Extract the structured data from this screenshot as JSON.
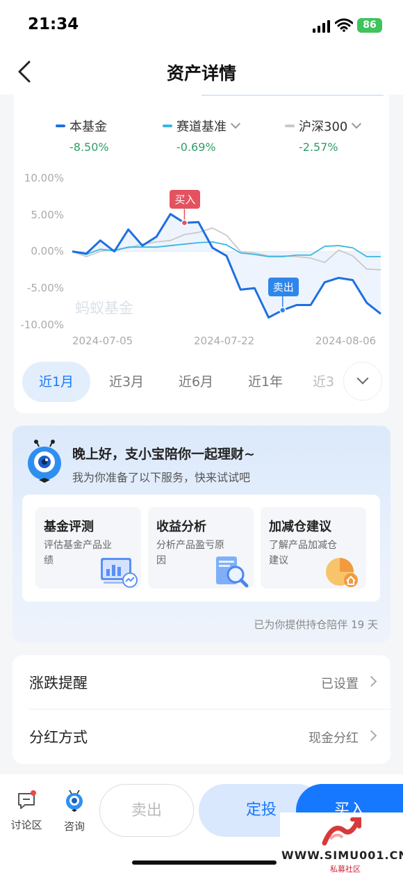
{
  "status": {
    "time": "21:34",
    "battery": "86"
  },
  "nav": {
    "title": "资产详情"
  },
  "legend": [
    {
      "name": "本基金",
      "value": "-8.50%",
      "color": "#1e6fe0"
    },
    {
      "name": "赛道基准",
      "value": "-0.69%",
      "color": "#3ab6e0"
    },
    {
      "name": "沪深300",
      "value": "-2.57%",
      "color": "#c9c9c9"
    }
  ],
  "chart_data": {
    "type": "line",
    "x_labels": [
      "2024-07-05",
      "2024-07-22",
      "2024-08-06"
    ],
    "ylim": [
      -10,
      10
    ],
    "yticks": [
      "10.00%",
      "5.00%",
      "0.00%",
      "-5.00%",
      "-10.00%"
    ],
    "series": [
      {
        "name": "本基金",
        "color": "#1e6fe0",
        "values": [
          0.0,
          -0.3,
          1.5,
          0.0,
          3.0,
          0.8,
          2.0,
          5.1,
          3.9,
          4.0,
          0.5,
          -0.6,
          -5.2,
          -5.0,
          -9.0,
          -8.0,
          -7.3,
          -7.3,
          -4.2,
          -3.6,
          -3.9,
          -7.0,
          -8.5
        ]
      },
      {
        "name": "赛道基准",
        "color": "#3ab6e0",
        "values": [
          0.0,
          -0.4,
          0.3,
          0.1,
          0.6,
          0.6,
          0.6,
          0.8,
          1.0,
          1.2,
          1.3,
          0.9,
          -0.2,
          -0.4,
          -0.7,
          -0.7,
          -0.5,
          -0.5,
          0.7,
          0.8,
          0.5,
          -0.7,
          -0.7
        ]
      },
      {
        "name": "沪深300",
        "color": "#c9c9c9",
        "values": [
          0.0,
          -0.7,
          0.0,
          0.3,
          0.5,
          1.0,
          1.3,
          1.5,
          2.3,
          2.6,
          3.2,
          2.2,
          0.0,
          -0.2,
          -0.6,
          -0.6,
          -0.7,
          -0.9,
          -1.5,
          0.2,
          -0.6,
          -2.4,
          -2.5
        ]
      }
    ],
    "annotations": [
      {
        "text": "买入",
        "index": 8,
        "series": 0,
        "color": "#e4525f"
      },
      {
        "text": "卖出",
        "index": 15,
        "series": 0,
        "color": "#2f86ea"
      }
    ],
    "watermark": "蚂蚁基金"
  },
  "range_tabs": [
    "近1月",
    "近3月",
    "近6月",
    "近1年",
    "近3"
  ],
  "assistant": {
    "greeting": "晚上好，支小宝陪你一起理财~",
    "subtitle": "我为你准备了以下服务，快来试试吧",
    "services": [
      {
        "title": "基金评测",
        "desc": "评估基金产品业绩",
        "icon": "chart-board-icon"
      },
      {
        "title": "收益分析",
        "desc": "分析产品盈亏原因",
        "icon": "magnifier-report-icon"
      },
      {
        "title": "加减仓建议",
        "desc": "了解产品加减仓建议",
        "icon": "pie-house-icon"
      }
    ],
    "footer": "已为你提供持仓陪伴 19 天"
  },
  "settings": [
    {
      "label": "涨跌提醒",
      "value": "已设置"
    },
    {
      "label": "分红方式",
      "value": "现金分红"
    }
  ],
  "bottom": {
    "discuss": "讨论区",
    "consult": "咨询",
    "sell": "卖出",
    "dingtou": "定投",
    "buy": "买入"
  },
  "site_watermark": {
    "url": "WWW.SIMU001.CN",
    "sub": "私募社区"
  }
}
